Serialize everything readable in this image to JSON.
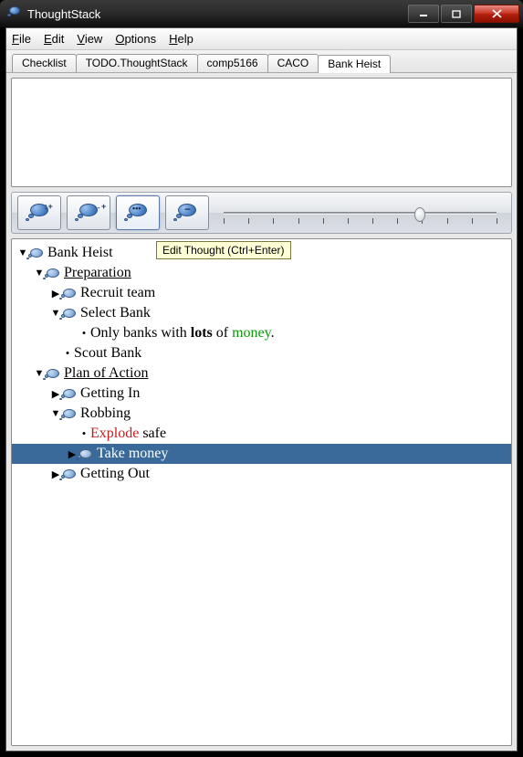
{
  "window": {
    "title": "ThoughtStack"
  },
  "menus": {
    "file": "File",
    "edit": "Edit",
    "view": "View",
    "options": "Options",
    "help": "Help"
  },
  "tabs": [
    "Checklist",
    "TODO.ThoughtStack",
    "comp5166",
    "CACO",
    "Bank Heist"
  ],
  "active_tab_index": 4,
  "tooltip": "Edit Thought (Ctrl+Enter)",
  "slider": {
    "value": 72,
    "ticks": 12
  },
  "tree": {
    "root": "Bank Heist",
    "preparation": "Preparation",
    "recruit": "Recruit team",
    "select_bank": "Select Bank",
    "only_pre": "Only banks with ",
    "only_bold": "lots",
    "only_mid": " of ",
    "only_green": "money",
    "only_dot": ".",
    "scout": "Scout Bank",
    "plan": "Plan of Action",
    "getting_in": "Getting In",
    "robbing": "Robbing",
    "explode_red": "Explode",
    "explode_rest": " safe",
    "take_money": "Take money",
    "getting_out": "Getting Out"
  }
}
